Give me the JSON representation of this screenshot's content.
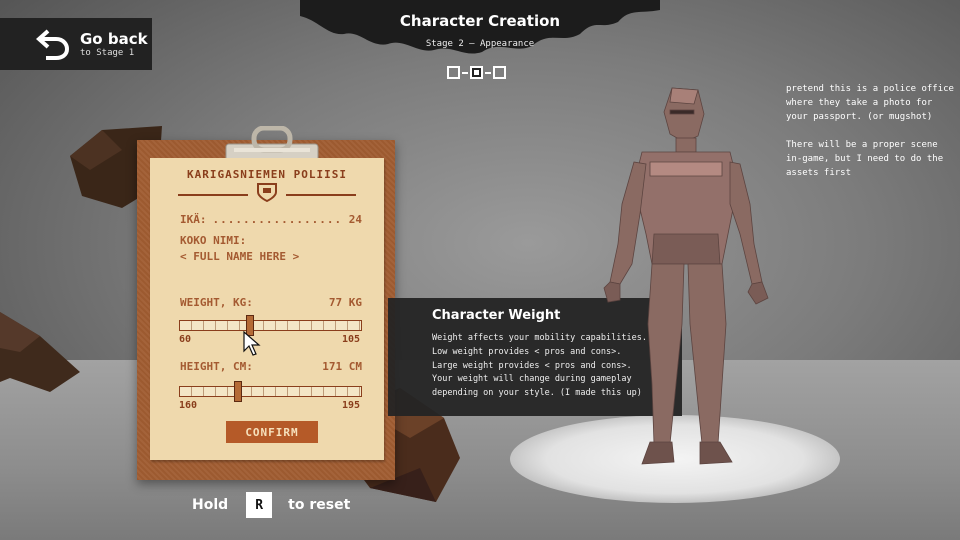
{
  "header": {
    "title": "Character Creation",
    "subtitle": "Stage 2 — Appearance",
    "steps": [
      "step-1",
      "step-2",
      "step-3"
    ],
    "active_step": 2
  },
  "go_back": {
    "label": "Go back",
    "sub": "to Stage 1"
  },
  "note": {
    "paragraph_1": "pretend this is a police office where they take a photo for your passport. (or mugshot)",
    "paragraph_2": "There will be a proper scene in-game, but I need to do the assets first"
  },
  "form": {
    "org": "KARIGASNIEMEN POLIISI",
    "age_label": "IKÄ:",
    "age_dots": ".................",
    "age_value": "24",
    "name_label": "KOKO NIMI:",
    "name_value": "< FULL NAME HERE >",
    "weight_label": "WEIGHT, KG:",
    "weight_value": "77 KG",
    "weight_min": "60",
    "weight_max": "105",
    "weight_fraction": 0.38,
    "height_label": "HEIGHT, CM:",
    "height_value": "171 CM",
    "height_min": "160",
    "height_max": "195",
    "height_fraction": 0.31,
    "confirm_label": "CONFIRM"
  },
  "tooltip": {
    "title": "Character Weight",
    "lines": [
      "Weight affects your mobility capabilities.",
      "Low weight provides < pros and cons>.",
      "Large weight provides < pros and cons>.",
      "Your weight will change during gameplay",
      "depending on your style. (I made this up)"
    ]
  },
  "reset_hint": {
    "prefix": "Hold",
    "key": "R",
    "suffix": "to reset"
  },
  "colors": {
    "paper": "#efd9ad",
    "ink": "#a45a31",
    "board": "#9c5a30",
    "button": "#b55a28",
    "panel": "#222222",
    "skin": "#8a6a62"
  },
  "icons": {
    "back": "back-arrow-icon",
    "badge": "police-badge-icon",
    "cursor": "mouse-pointer-icon"
  }
}
